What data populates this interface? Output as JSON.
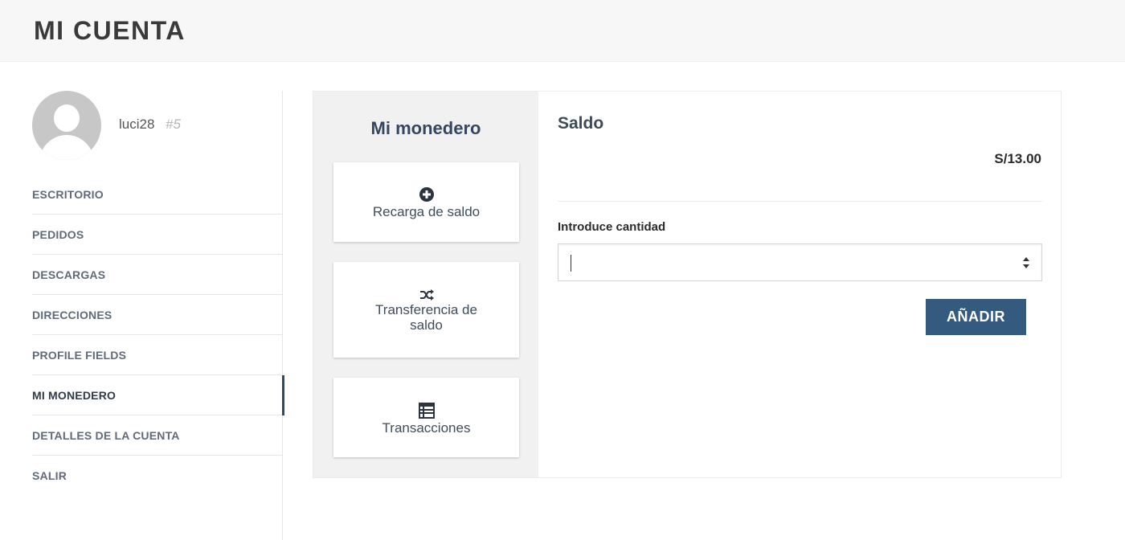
{
  "page": {
    "title": "MI CUENTA"
  },
  "user": {
    "username": "luci28",
    "id": "#5"
  },
  "sidebar": {
    "items": [
      {
        "label": "ESCRITORIO"
      },
      {
        "label": "PEDIDOS"
      },
      {
        "label": "DESCARGAS"
      },
      {
        "label": "DIRECCIONES"
      },
      {
        "label": "PROFILE FIELDS"
      },
      {
        "label": "MI MONEDERO",
        "active": true
      },
      {
        "label": "DETALLES DE LA CUENTA"
      },
      {
        "label": "SALIR"
      }
    ]
  },
  "wallet": {
    "title": "Mi monedero",
    "options": [
      {
        "label": "Recarga de saldo",
        "icon": "plus-circle-icon"
      },
      {
        "label": "Transferencia de saldo",
        "icon": "shuffle-icon"
      },
      {
        "label": "Transacciones",
        "icon": "list-icon"
      }
    ]
  },
  "balance": {
    "title": "Saldo",
    "amount": "S/13.00",
    "input_label": "Introduce cantidad",
    "input_value": "",
    "add_label": "AÑADIR"
  },
  "colors": {
    "accent": "#345a80",
    "heading": "#34475e",
    "active_indicator": "#2f4a68"
  }
}
